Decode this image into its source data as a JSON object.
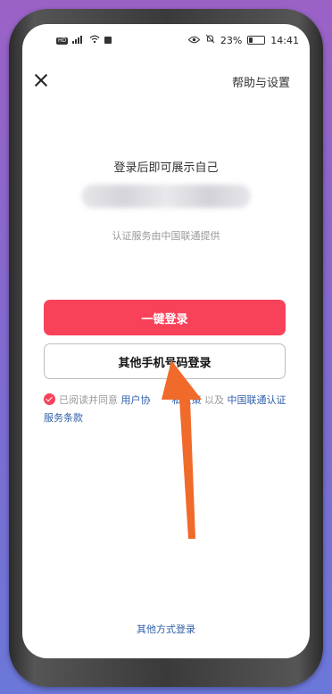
{
  "status_bar": {
    "left_badge": "HD",
    "battery_text": "23%",
    "battery_level": 0.23,
    "time": "14:41"
  },
  "header": {
    "help_settings": "帮助与设置"
  },
  "login": {
    "subtitle": "登录后即可展示自己",
    "provider_note": "认证服务由中国联通提供",
    "one_click_button": "一键登录",
    "other_phone_button": "其他手机号码登录"
  },
  "agreement": {
    "prefix": "已阅读并同意 ",
    "user_agreement": "用户协",
    "privacy_policy": "私政策",
    "and": " 以及 ",
    "carrier_terms": "中国联通认证服务条款"
  },
  "footer": {
    "other_methods": "其他方式登录"
  },
  "colors": {
    "accent": "#f7425a",
    "link": "#2f5fa8",
    "arrow": "#f06a2a"
  }
}
